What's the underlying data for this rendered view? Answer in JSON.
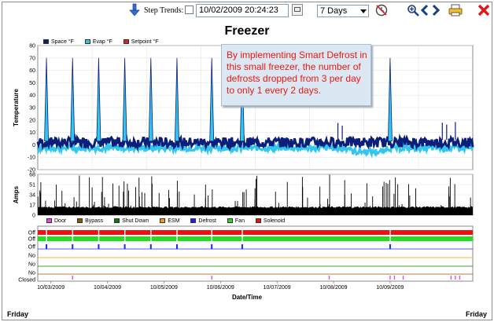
{
  "toolbar": {
    "step_trends_label": "Step Trends:",
    "step_trends_checked": false,
    "datetime_value": "10/02/2009 20:24:23",
    "range_value": "7 Days",
    "icons": [
      "down-arrow-icon",
      "calendar-icon",
      "history-icon",
      "zoom-icon",
      "previous-icon",
      "next-icon",
      "print-icon",
      "close-icon"
    ]
  },
  "colors": {
    "space": "#0a1f7a",
    "evap": "#31c6f0",
    "setpoint": "#e02020",
    "door": "#ee44ee",
    "bypass": "#8b5a00",
    "shutdown": "#008000",
    "esm": "#ff9900",
    "defrost": "#2020ff",
    "fan": "#22dd22",
    "solenoid": "#ee1111",
    "annotation_text": "#e8190e"
  },
  "annotation": {
    "text": "By implementing Smart Defrost in this small freezer, the number of defrosts dropped from 3 per day to only 1 every 2 days."
  },
  "day_left": "Friday",
  "day_right": "Friday",
  "chart_data": [
    {
      "type": "line",
      "title": "Freezer",
      "ylabel": "Temperature",
      "ylim": [
        -20,
        80
      ],
      "yticks": [
        -20,
        -10,
        0,
        10,
        20,
        30,
        40,
        50,
        60,
        70,
        80
      ],
      "legend": [
        "Space °F",
        "Evap °F",
        "Setpoint °F"
      ],
      "series": [
        {
          "name": "Space °F",
          "baseline_range": [
            -2,
            6
          ],
          "spike_x": [
            0.02,
            0.08,
            0.14,
            0.2,
            0.26,
            0.32,
            0.4,
            0.47,
            0.81
          ],
          "spike_y": [
            70,
            70,
            70,
            70,
            70,
            70,
            70,
            70,
            70
          ]
        },
        {
          "name": "Evap °F",
          "baseline_range": [
            -5,
            0
          ]
        }
      ],
      "grid": true
    },
    {
      "type": "line",
      "ylabel": "Amps",
      "ylim": [
        0,
        68
      ],
      "yticks": [
        0,
        17,
        34,
        51,
        68
      ],
      "yticklabels": [
        "0",
        "17",
        "34",
        "51",
        "68"
      ],
      "baseline_range": [
        8,
        12
      ],
      "spike_max": 68,
      "grid": true
    },
    {
      "type": "line",
      "legend": [
        "Door",
        "Bypass",
        "Shut Down",
        "ESM",
        "Defrost",
        "Fan",
        "Solenoid"
      ],
      "row_labels": [
        "Off",
        "Off",
        "Off",
        "No",
        "No",
        "No",
        "Closed"
      ],
      "xticks": [
        "10/03/2009",
        "10/04/2009",
        "10/05/2009",
        "10/06/2009",
        "10/07/2009",
        "10/08/2009",
        "10/09/2009"
      ],
      "xlabel": "Date/Time",
      "defrost_events_x": [
        0.02,
        0.08,
        0.14,
        0.2,
        0.26,
        0.32,
        0.4,
        0.47,
        0.81
      ],
      "door_events_x": [
        0.08,
        0.4,
        0.67,
        0.81,
        0.82,
        0.84,
        0.95,
        0.96,
        0.97
      ]
    }
  ]
}
